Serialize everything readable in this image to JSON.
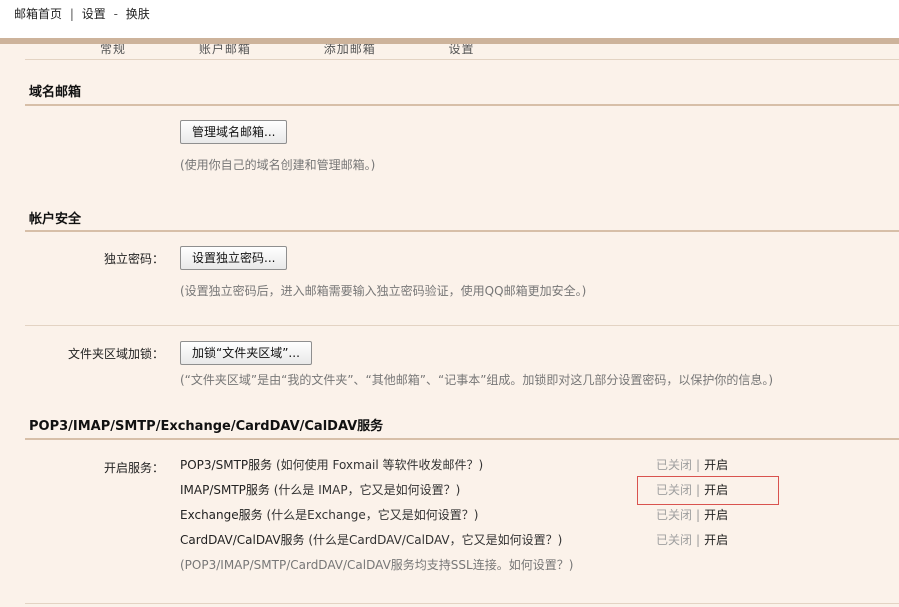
{
  "breadcrumb": {
    "home": "邮箱首页",
    "sep": "|",
    "settings": "设置",
    "dash": "-",
    "current": "换肤"
  },
  "ghost_tabs": [
    "常规",
    "账户邮箱",
    "添加邮箱",
    "设置"
  ],
  "domain_section": {
    "title": "域名邮箱",
    "button": "管理域名邮箱...",
    "hint": "(使用你自己的域名创建和管理邮箱。)"
  },
  "security_section": {
    "title": "帐户安全",
    "pwd_label": "独立密码：",
    "pwd_button": "设置独立密码...",
    "pwd_hint": "(设置独立密码后，进入邮箱需要输入独立密码验证，使用QQ邮箱更加安全。)",
    "folder_label": "文件夹区域加锁：",
    "folder_button": "加锁“文件夹区域”...",
    "folder_hint": "(“文件夹区域”是由“我的文件夹”、“其他邮箱”、“记事本”组成。加锁即对这几部分设置密码，以保护你的信息。)"
  },
  "services_section": {
    "title": "POP3/IMAP/SMTP/Exchange/CardDAV/CalDAV服务",
    "label": "开启服务：",
    "rows": [
      {
        "name": "POP3/SMTP服务",
        "help": "(如何使用 Foxmail 等软件收发邮件？)",
        "closed": "已关闭",
        "sep": "|",
        "open": "开启"
      },
      {
        "name": "IMAP/SMTP服务",
        "help": "(什么是 IMAP，它又是如何设置？)",
        "closed": "已关闭",
        "sep": "|",
        "open": "开启"
      },
      {
        "name": "Exchange服务",
        "help": "(什么是Exchange，它又是如何设置？)",
        "closed": "已关闭",
        "sep": "|",
        "open": "开启"
      },
      {
        "name": "CardDAV/CalDAV服务",
        "help": "(什么是CardDAV/CalDAV，它又是如何设置？)",
        "closed": "已关闭",
        "sep": "|",
        "open": "开启"
      }
    ],
    "footnote": "(POP3/IMAP/SMTP/CardDAV/CalDAV服务均支持SSL连接。如何设置？)"
  },
  "colors": {
    "background": "#fbf2ea",
    "band": "#cdb39b",
    "highlight": "#d9534f"
  }
}
